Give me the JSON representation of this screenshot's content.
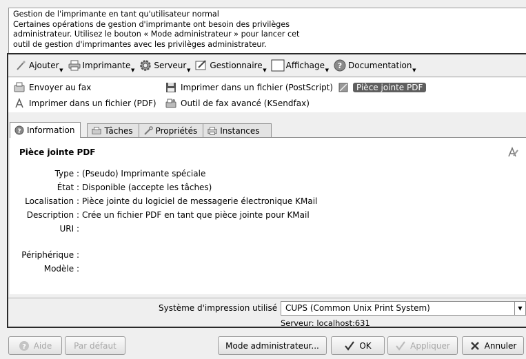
{
  "notice": {
    "lines": [
      "Gestion de l'imprimante en tant qu'utilisateur normal",
      "Certaines opérations de gestion d'imprimante ont besoin des privilèges",
      "administrateur. Utilisez le bouton « Mode administrateur » pour lancer cet",
      "outil de gestion d'imprimantes avec les privilèges administrateur."
    ]
  },
  "toolbar": {
    "ajouter": "Ajouter",
    "imprimante": "Imprimante",
    "serveur": "Serveur",
    "gestionnaire": "Gestionnaire",
    "affichage": "Affichage",
    "documentation": "Documentation"
  },
  "printers": {
    "fax": "Envoyer au fax",
    "postscript": "Imprimer dans un fichier (PostScript)",
    "pdf_attach": "Pièce jointe PDF",
    "pdf_file": "Imprimer dans un fichier (PDF)",
    "ksendfax": "Outil de fax avancé (KSendfax)"
  },
  "tabs": {
    "information": "Information",
    "taches": "Tâches",
    "proprietes": "Propriétés",
    "instances": "Instances"
  },
  "info": {
    "title": "Pièce jointe PDF",
    "rows": [
      {
        "key": "Type :",
        "value": "(Pseudo) Imprimante spéciale"
      },
      {
        "key": "État :",
        "value": "Disponible (accepte les tâches)"
      },
      {
        "key": "Localisation :",
        "value": "Pièce jointe du logiciel de messagerie électronique KMail"
      },
      {
        "key": "Description :",
        "value": "Crée un fichier PDF en tant que pièce jointe pour KMail"
      },
      {
        "key": "URI :",
        "value": ""
      },
      {
        "key": "Périphérique :",
        "value": ""
      },
      {
        "key": "Modèle :",
        "value": ""
      }
    ]
  },
  "system": {
    "label": "Système d'impression utilisé :",
    "value": "CUPS (Common Unix Print System)",
    "server": "Serveur: localhost:631"
  },
  "buttons": {
    "aide": "Aide",
    "defaut": "Par défaut",
    "admin": "Mode administrateur...",
    "ok": "OK",
    "appliquer": "Appliquer",
    "annuler": "Annuler"
  },
  "colors": {
    "selection": "#5f5f5f",
    "frame": "#2a2a2a"
  }
}
